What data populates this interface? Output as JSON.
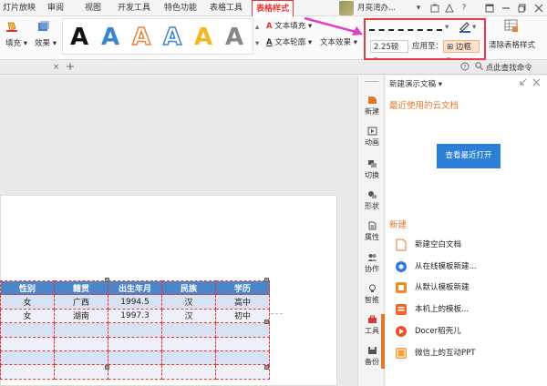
{
  "menubar": {
    "items": [
      "灯片放映",
      "审阅",
      "视图",
      "开发工具",
      "特色功能",
      "表格工具",
      "表格样式"
    ],
    "user_name": "月亮湾办...",
    "user_menu_arrow": "▾"
  },
  "ribbon": {
    "fill_label": "填充",
    "effect_label": "效果",
    "art_letter": "A",
    "text_fill_label": "文本填充",
    "text_outline_label": "文本轮廓",
    "text_effect_label": "文本效果",
    "line_weight_value": "2.25磅",
    "apply_to_label": "应用至：",
    "border_label": "边框",
    "clear_style_label": "清除表格样式"
  },
  "tabstrip": {
    "close_glyph": "×",
    "add_glyph": "+",
    "search_label": "点此查找命令"
  },
  "table": {
    "headers": [
      "性别",
      "籍贯",
      "出生年月",
      "民族",
      "学历"
    ],
    "rows": [
      [
        "女",
        "广西",
        "1994.5",
        "汉",
        "高中"
      ],
      [
        "女",
        "湖南",
        "1997.3",
        "汉",
        "初中"
      ],
      [
        "",
        "",
        "",
        "",
        ""
      ],
      [
        "",
        "",
        "",
        "",
        ""
      ],
      [
        "",
        "",
        "",
        "",
        ""
      ],
      [
        "",
        "",
        "",
        "",
        ""
      ]
    ]
  },
  "side_tools": [
    {
      "label": "新建",
      "icon": "new-icon"
    },
    {
      "label": "动画",
      "icon": "animation-icon"
    },
    {
      "label": "切换",
      "icon": "switch-icon"
    },
    {
      "label": "形状",
      "icon": "shape-icon"
    },
    {
      "label": "属性",
      "icon": "property-icon"
    },
    {
      "label": "协作",
      "icon": "collab-icon"
    },
    {
      "label": "智推",
      "icon": "smart-icon"
    },
    {
      "label": "工具",
      "icon": "tool-icon"
    },
    {
      "label": "备份",
      "icon": "backup-icon"
    }
  ],
  "pane": {
    "title": "新建演示文稿",
    "recent_header": "最近使用的云文档",
    "open_recent_button": "查看最近打开",
    "new_header": "新建",
    "items": [
      {
        "label": "新建空白文档",
        "icon": "blank-doc-icon",
        "color": "#ffffff"
      },
      {
        "label": "从在线模板新建...",
        "icon": "online-template-icon",
        "color": "#2f7bd8"
      },
      {
        "label": "从默认模板新建",
        "icon": "default-template-icon",
        "color": "#f08a24"
      },
      {
        "label": "本机上的模板...",
        "icon": "local-template-icon",
        "color": "#e86a2a"
      },
      {
        "label": "Docer稻壳儿",
        "icon": "docer-icon",
        "color": "#e8502a"
      },
      {
        "label": "微信上的互动PPT",
        "icon": "wechat-ppt-icon",
        "color": "#f0a23a"
      }
    ]
  },
  "colors": {
    "accent_red": "#e8384a",
    "table_header": "#4a86c8",
    "button_blue": "#2b7fd6",
    "pane_orange": "#e0782c"
  }
}
